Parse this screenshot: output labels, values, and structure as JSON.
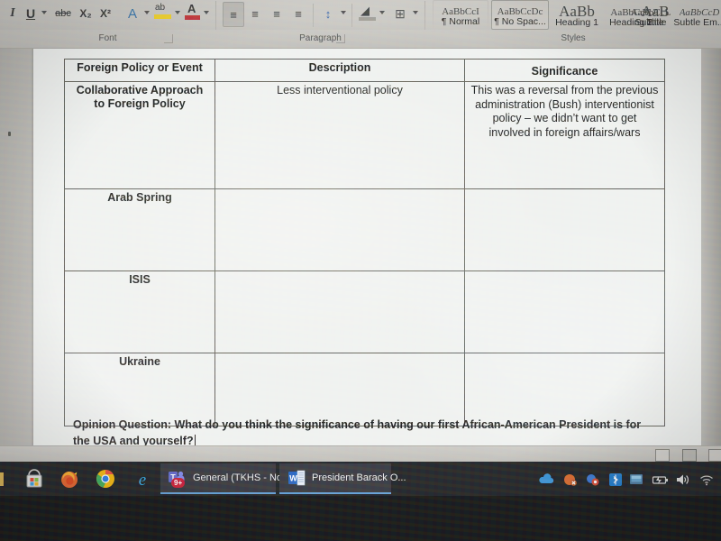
{
  "app": {
    "name": "Microsoft Word",
    "document_title": "President Barack O..."
  },
  "ribbon": {
    "font_group": {
      "label": "Font",
      "launcher": "dialog-launcher",
      "buttons": [
        {
          "name": "italic",
          "glyph": "I"
        },
        {
          "name": "underline",
          "glyph": "U"
        },
        {
          "name": "strikethrough",
          "glyph": "abc"
        },
        {
          "name": "subscript",
          "glyph": "X₂"
        },
        {
          "name": "superscript",
          "glyph": "X²"
        },
        {
          "name": "text-effects",
          "glyph": "A"
        },
        {
          "name": "text-highlight-color",
          "glyph": "ab"
        },
        {
          "name": "font-color",
          "glyph": "A"
        }
      ]
    },
    "paragraph_group": {
      "label": "Paragraph",
      "launcher": "dialog-launcher",
      "buttons": [
        {
          "name": "align-left",
          "glyph": "≡",
          "active": true
        },
        {
          "name": "align-center",
          "glyph": "≡",
          "active": false
        },
        {
          "name": "align-right",
          "glyph": "≡",
          "active": false
        },
        {
          "name": "justify",
          "glyph": "≡",
          "active": false
        },
        {
          "name": "line-spacing",
          "glyph": "↕",
          "active": false
        },
        {
          "name": "shading",
          "glyph": "◢",
          "active": false
        },
        {
          "name": "borders",
          "glyph": "⊞",
          "active": false
        }
      ]
    },
    "styles_group": {
      "label": "Styles",
      "items": [
        {
          "name": "Normal",
          "preview": "AaBbCcI",
          "marker": "¶",
          "selected": false,
          "boxed": false
        },
        {
          "name": "No Spac...",
          "preview": "AaBbCcDc",
          "marker": "¶",
          "selected": true,
          "boxed": false
        },
        {
          "name": "Heading 1",
          "preview": "AaBb",
          "marker": "",
          "selected": false,
          "boxed": false
        },
        {
          "name": "Heading 2",
          "preview": "AaBbCcC",
          "marker": "",
          "selected": false,
          "boxed": false
        },
        {
          "name": "Title",
          "preview": "AaB",
          "marker": "",
          "selected": false,
          "boxed": false
        },
        {
          "name": "Subtitle",
          "preview": "AaBbCcL",
          "marker": "",
          "selected": false,
          "boxed": false
        },
        {
          "name": "Subtle Em...",
          "preview": "AaBbCcD",
          "marker": "",
          "selected": false,
          "boxed": false
        }
      ]
    }
  },
  "document": {
    "table": {
      "headers": [
        "Foreign Policy or Event",
        "Description",
        "Significance"
      ],
      "rows": [
        {
          "policy": "Collaborative Approach to Foreign Policy",
          "description": "Less interventional policy",
          "significance": "This was a reversal from the previous administration (Bush) interventionist policy – we didn’t want to get involved in foreign affairs/wars"
        },
        {
          "policy": "Arab Spring",
          "description": "",
          "significance": ""
        },
        {
          "policy": "ISIS",
          "description": "",
          "significance": ""
        },
        {
          "policy": "Ukraine",
          "description": "",
          "significance": ""
        }
      ]
    },
    "opinion_question": "Opinion Question: What do you think the significance of having our first African-American President is for the USA and yourself?"
  },
  "status_bar": {
    "view_buttons": [
      {
        "name": "read-mode",
        "selected": false
      },
      {
        "name": "print-layout",
        "selected": true
      },
      {
        "name": "web-layout",
        "selected": false
      }
    ]
  },
  "taskbar": {
    "pinned": [
      {
        "name": "microsoft-store-icon"
      },
      {
        "name": "firefox-icon"
      },
      {
        "name": "chrome-icon"
      },
      {
        "name": "internet-explorer-icon"
      }
    ],
    "windows": [
      {
        "name": "microsoft-teams",
        "label": "General (TKHS - No...",
        "badge": "9+",
        "active": true
      },
      {
        "name": "microsoft-word",
        "label": "President Barack O...",
        "badge": "",
        "active": true
      }
    ],
    "tray": [
      {
        "name": "onedrive-icon"
      },
      {
        "name": "notification-muted-icon"
      },
      {
        "name": "app-alert-icon"
      },
      {
        "name": "bluetooth-icon"
      },
      {
        "name": "display-settings-icon"
      },
      {
        "name": "battery-icon"
      },
      {
        "name": "volume-icon"
      },
      {
        "name": "wifi-icon"
      }
    ]
  },
  "colors": {
    "ribbon_bg": "#c9c7c2",
    "page_bg": "#eef0ee",
    "table_border": "#55544f",
    "taskbar_bg": "#141418",
    "accent": "#5b9bd5"
  }
}
